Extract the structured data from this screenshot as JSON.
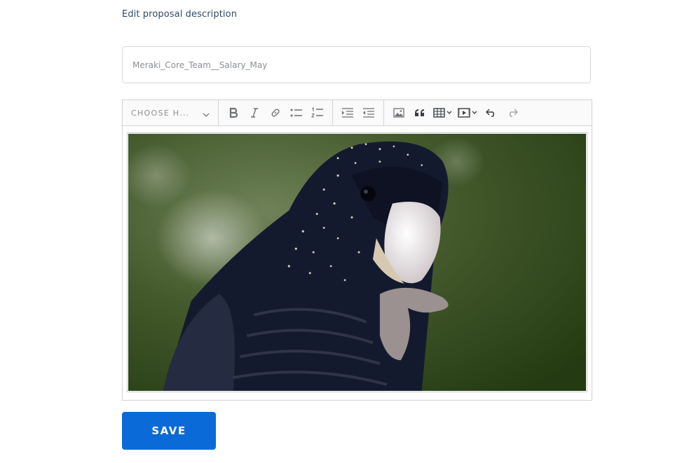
{
  "page": {
    "heading": "Edit proposal description"
  },
  "title_field": {
    "value": "Meraki_Core_Team__Salary_May"
  },
  "toolbar": {
    "heading_select_label": "CHOOSE H...",
    "buttons": [
      {
        "icon": "bold-icon"
      },
      {
        "icon": "italic-icon"
      },
      {
        "icon": "link-icon"
      },
      {
        "icon": "bulleted-list-icon"
      },
      {
        "icon": "numbered-list-icon"
      },
      {
        "icon": "indent-icon"
      },
      {
        "icon": "outdent-icon"
      },
      {
        "icon": "image-icon"
      },
      {
        "icon": "blockquote-icon"
      },
      {
        "icon": "table-icon"
      },
      {
        "icon": "media-embed-icon"
      },
      {
        "icon": "undo-icon"
      },
      {
        "icon": "redo-icon"
      }
    ]
  },
  "editor": {
    "image_subject": "black cockatoo photo"
  },
  "actions": {
    "save_label": "SAVE"
  },
  "colors": {
    "primary": "#0a6ad8",
    "heading_text": "#2f4a66",
    "border": "#d0d3d6"
  }
}
